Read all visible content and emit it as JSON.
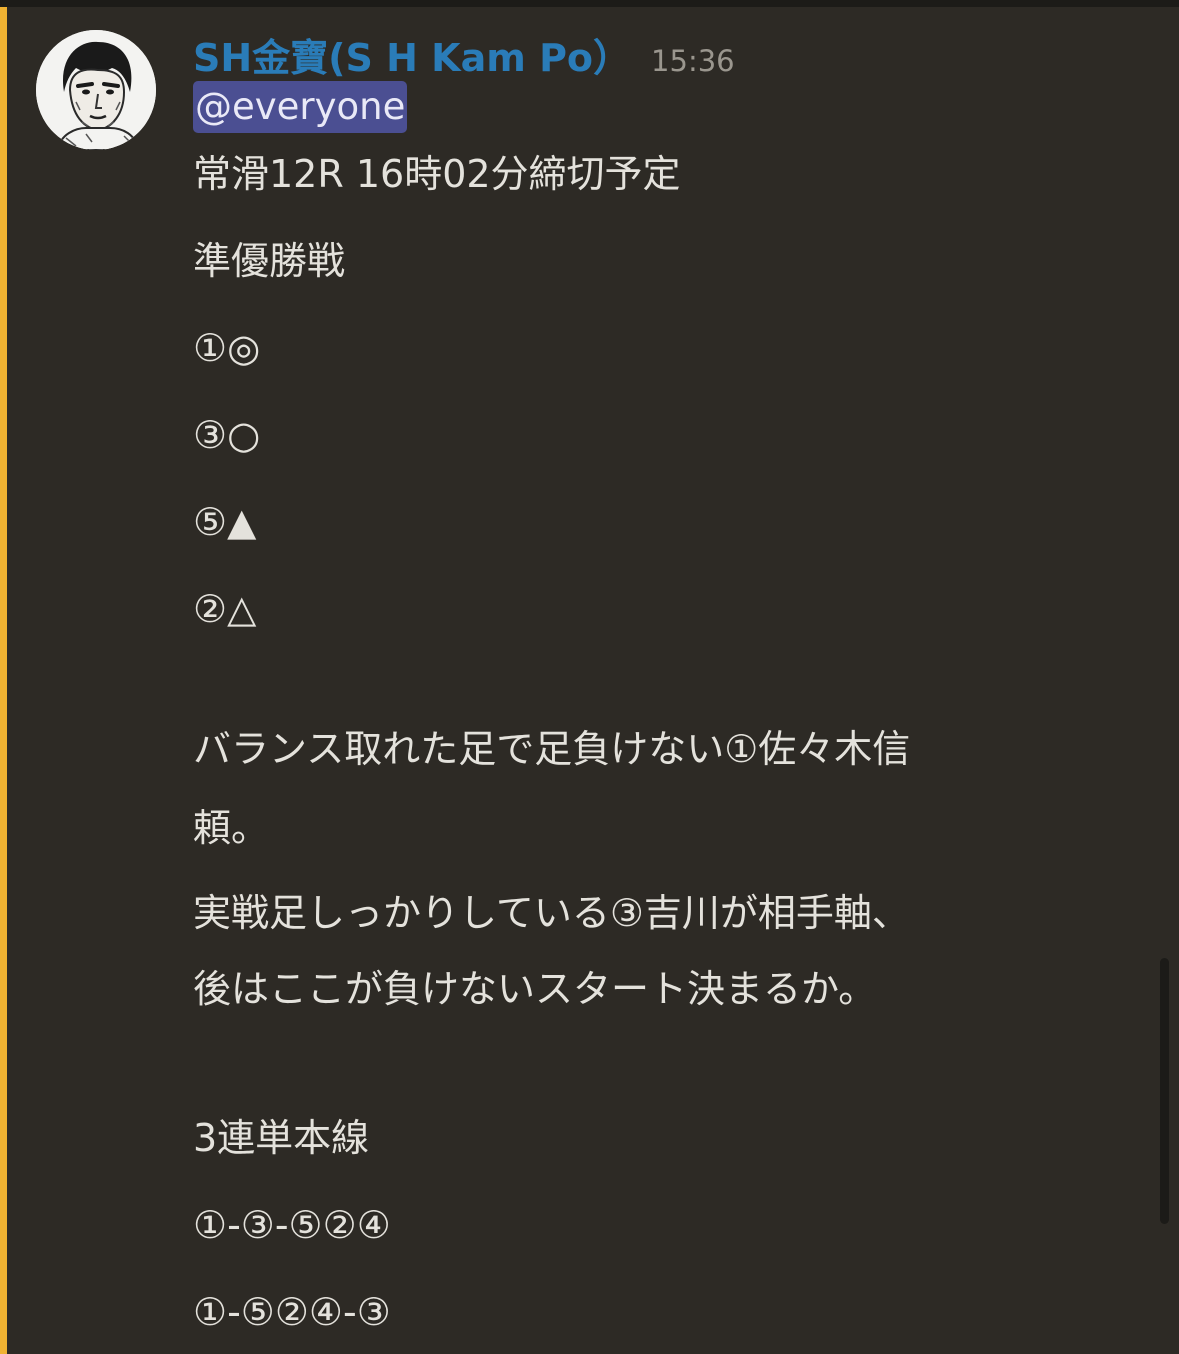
{
  "message": {
    "username": "SH金寶(S H Kam Po）",
    "timestamp": "15:36",
    "mention": "@everyone",
    "lines": [
      "常滑12R 16時02分締切予定",
      "準優勝戦",
      "①◎",
      "③○",
      "⑤▲",
      "②△",
      "バランス取れた足で足負けない①佐々木信",
      "頼。",
      "実戦足しっかりしている③吉川が相手軸、",
      "後はここが負けないスタート決まるか。",
      "3連単本線",
      "①-③-⑤②④",
      "①-⑤②④-③"
    ]
  },
  "colors": {
    "background": "#2d2a25",
    "mention_bar": "#f0b232",
    "username": "#2a7cb8",
    "mention_bg": "#4b4f92",
    "text": "#e4e2dc"
  },
  "icons": {
    "avatar": "avatar-illustration-icon"
  }
}
